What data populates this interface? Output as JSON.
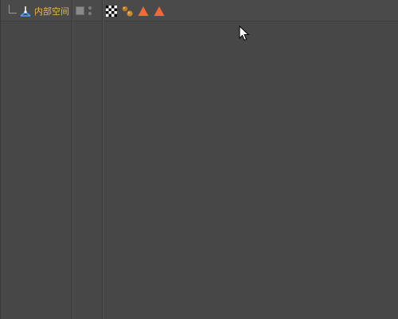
{
  "object_manager": {
    "item": {
      "label": "内部空间",
      "icon": "null-object-icon",
      "label_color": "#e8b64a"
    },
    "layer_color": "#8a8a8a",
    "tags": [
      {
        "icon": "texture-checker-tag-icon"
      },
      {
        "icon": "material-spheres-tag-icon"
      },
      {
        "icon": "triangle-tag-icon",
        "color": "#f26a35"
      },
      {
        "icon": "triangle-tag-icon",
        "color": "#f26a35"
      }
    ]
  }
}
